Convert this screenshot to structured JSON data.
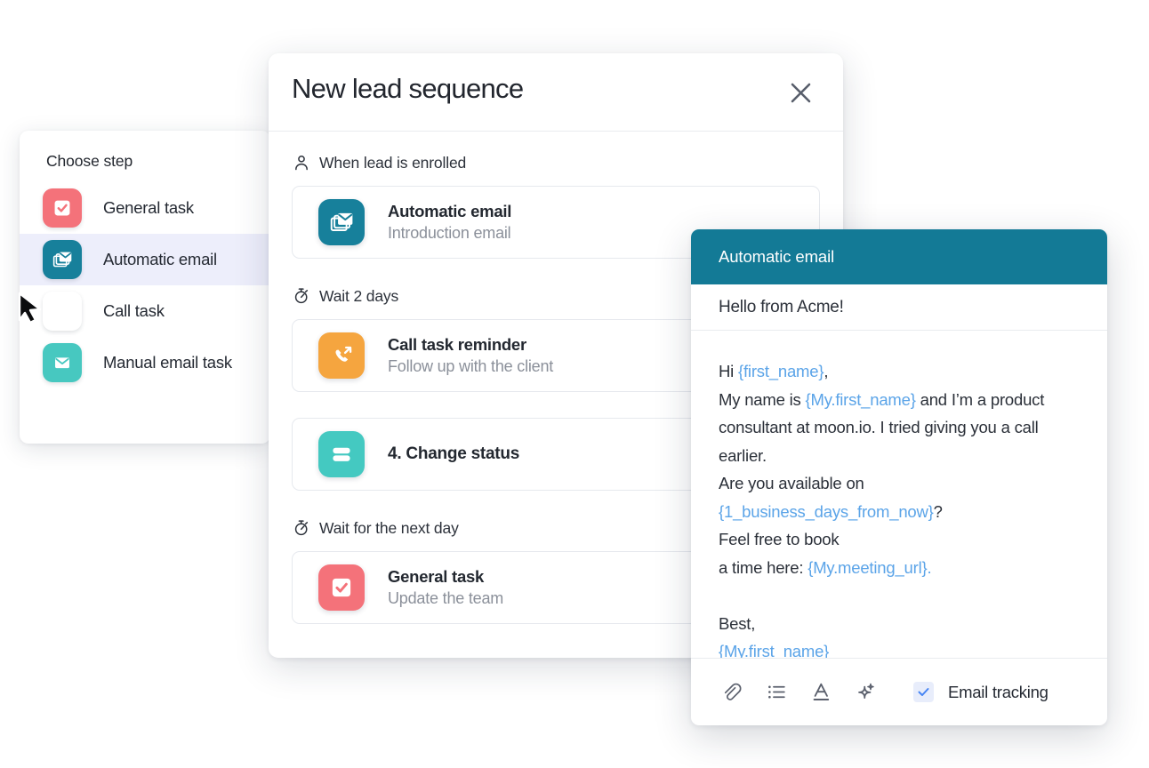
{
  "step_picker": {
    "title": "Choose step",
    "items": [
      {
        "label": "General task",
        "icon": "checkbox-task-icon",
        "color": "#f4727a",
        "selected": false
      },
      {
        "label": "Automatic email",
        "icon": "stacked-envelope-icon",
        "color": "#17809b",
        "selected": true
      },
      {
        "label": "Call task",
        "icon": "outgoing-call-icon",
        "color": "#f5a council",
        "selected": false
      },
      {
        "label": "Manual email task",
        "icon": "envelope-icon",
        "color": "#47c8c0",
        "selected": false
      }
    ]
  },
  "sequence_dialog": {
    "title": "New lead sequence",
    "close_label": "×",
    "groups": [
      {
        "head_icon": "person-icon",
        "head_label": "When lead is enrolled",
        "cards": [
          {
            "title": "Automatic email",
            "subtitle": "Introduction email",
            "icon": "stacked-envelope-icon",
            "color": "#17809b"
          }
        ]
      },
      {
        "head_icon": "stopwatch-icon",
        "head_label": "Wait 2 days",
        "cards": [
          {
            "title": "Call task reminder",
            "subtitle": "Follow up with the client",
            "icon": "outgoing-call-icon",
            "color": "#f5a53f"
          },
          {
            "title": "4. Change status",
            "subtitle": "",
            "icon": "status-bars-icon",
            "color": "#44c9c1"
          }
        ]
      },
      {
        "head_icon": "stopwatch-icon",
        "head_label": "Wait for the next day",
        "cards": [
          {
            "title": "General task",
            "subtitle": "Update the team",
            "icon": "checkbox-task-icon",
            "color": "#f4727a"
          }
        ]
      }
    ]
  },
  "email_panel": {
    "header_title": "Automatic email",
    "subject": "Hello from Acme!",
    "body_lines": [
      [
        {
          "t": "Hi ",
          "k": "p"
        },
        {
          "t": "{first_name}",
          "k": "v"
        },
        {
          "t": ",",
          "k": "p"
        }
      ],
      [
        {
          "t": "My name is ",
          "k": "p"
        },
        {
          "t": "{My.first_name}",
          "k": "v"
        },
        {
          "t": " and I’m a product",
          "k": "p"
        }
      ],
      [
        {
          "t": "consultant at moon.io. I tried giving you a call",
          "k": "p"
        }
      ],
      [
        {
          "t": "earlier.",
          "k": "p"
        }
      ],
      [
        {
          "t": "Are you available on ",
          "k": "p"
        },
        {
          "t": "{1_business_days_from_now}",
          "k": "v"
        },
        {
          "t": "?",
          "k": "p"
        }
      ],
      [
        {
          "t": "Feel free to book",
          "k": "p"
        }
      ],
      [
        {
          "t": "a time here: ",
          "k": "p"
        },
        {
          "t": "{My.meeting_url}.",
          "k": "v"
        }
      ],
      [
        {
          "t": "",
          "k": "blank"
        }
      ],
      [
        {
          "t": "Best,",
          "k": "p"
        }
      ],
      [
        {
          "t": "{My.first_name}",
          "k": "v"
        }
      ]
    ],
    "toolbar": {
      "buttons": [
        {
          "name": "attach-icon",
          "title": "Attach"
        },
        {
          "name": "bullet-list-icon",
          "title": "List"
        },
        {
          "name": "text-color-icon",
          "title": "Text color"
        },
        {
          "name": "ai-sparkle-icon",
          "title": "AI"
        }
      ],
      "tracking_label": "Email tracking",
      "tracking_checked": true,
      "accent": "#4785f4"
    }
  }
}
